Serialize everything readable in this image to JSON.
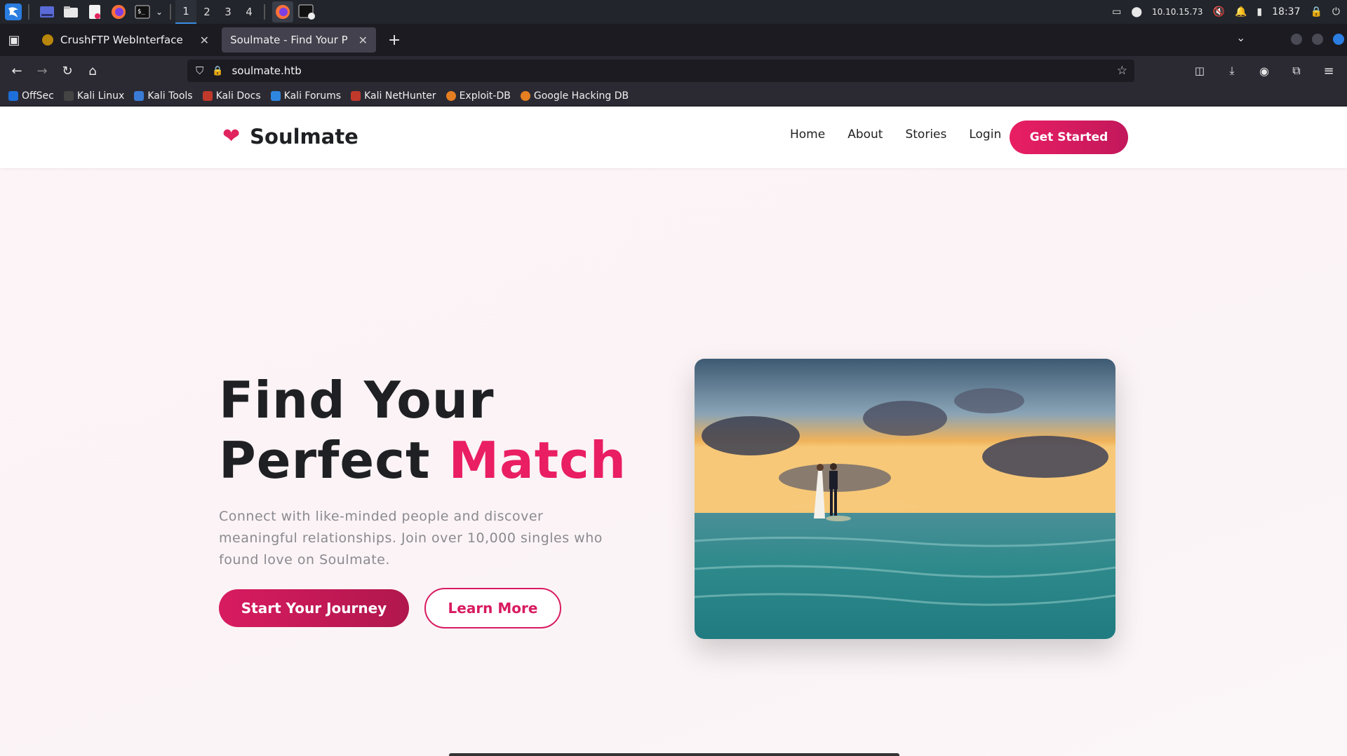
{
  "taskbar": {
    "workspaces": [
      "1",
      "2",
      "3",
      "4"
    ],
    "ip": "10.10.15.73",
    "time": "18:37"
  },
  "tabs": [
    {
      "title": "CrushFTP WebInterface",
      "favicon": "crushftp-icon"
    },
    {
      "title": "Soulmate - Find Your Perfect",
      "favicon": "none"
    }
  ],
  "url": "soulmate.htb",
  "bookmarks": [
    {
      "label": "OffSec",
      "color": "#1e6fd9"
    },
    {
      "label": "Kali Linux",
      "color": "#222"
    },
    {
      "label": "Kali Tools",
      "color": "#3a7bd5"
    },
    {
      "label": "Kali Docs",
      "color": "#c0392b"
    },
    {
      "label": "Kali Forums",
      "color": "#2e86de"
    },
    {
      "label": "Kali NetHunter",
      "color": "#c0392b"
    },
    {
      "label": "Exploit-DB",
      "color": "#e67e22"
    },
    {
      "label": "Google Hacking DB",
      "color": "#e67e22"
    }
  ],
  "site": {
    "brand": "Soulmate",
    "nav": [
      "Home",
      "About",
      "Stories",
      "Login"
    ],
    "cta": "Get Started",
    "hero": {
      "title_line1": "Find Your",
      "title_line2_a": "Perfect",
      "title_line2_b": "Match",
      "subtitle": "Connect with like-minded people and discover meaningful relationships. Join over 10,000 singles who found love on Soulmate.",
      "primary_button": "Start Your Journey",
      "secondary_button": "Learn More"
    },
    "accent_color": "#e91e63"
  }
}
